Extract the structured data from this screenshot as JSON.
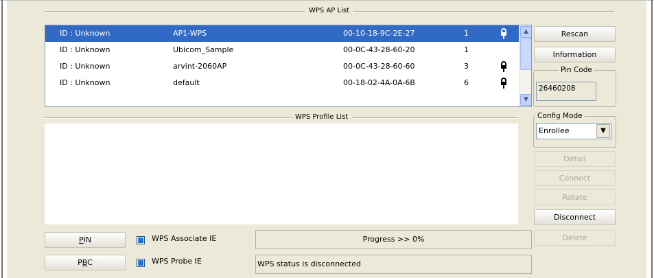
{
  "window": {
    "top_caption": ""
  },
  "ap_list": {
    "title": "WPS AP List",
    "rows": [
      {
        "id": "ID : Unknown",
        "ssid": "AP1-WPS",
        "mac": "00-10-18-9C-2E-27",
        "channel": "1",
        "lock": true,
        "selected": true
      },
      {
        "id": "ID : Unknown",
        "ssid": "Ubicom_Sample",
        "mac": "00-0C-43-28-60-20",
        "channel": "1",
        "lock": false,
        "selected": false
      },
      {
        "id": "ID : Unknown",
        "ssid": "arvint-2060AP",
        "mac": "00-0C-43-28-60-60",
        "channel": "3",
        "lock": true,
        "selected": false
      },
      {
        "id": "ID : Unknown",
        "ssid": "default",
        "mac": "00-18-02-4A-0A-6B",
        "channel": "6",
        "lock": true,
        "selected": false
      }
    ]
  },
  "profile_list": {
    "title": "WPS Profile List"
  },
  "side": {
    "rescan": "Rescan",
    "information": "Information",
    "pin_code_label": "Pin Code",
    "pin_code_value": "26460208",
    "config_mode_label": "Config Mode",
    "config_mode_value": "Enrollee",
    "detail": "Detail",
    "connect": "Connect",
    "rotate": "Rotate",
    "disconnect": "Disconnect",
    "delete": "Delete"
  },
  "bottom": {
    "pin_button_prefix": "",
    "pin_button_u": "P",
    "pin_button_rest": "IN",
    "pbc_button_prefix": "P",
    "pbc_button_u": "B",
    "pbc_button_rest": "C",
    "associate_label": "WPS Associate IE",
    "probe_label": "WPS Probe IE",
    "progress_text": "Progress >> 0%",
    "status_text": "WPS status is disconnected"
  },
  "colors": {
    "selection": "#316ac5",
    "panel": "#ece9d8"
  }
}
